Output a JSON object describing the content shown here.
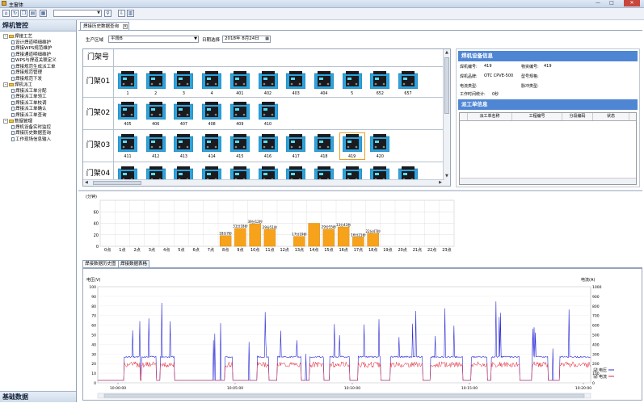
{
  "window": {
    "title": "主窗体",
    "buttons": [
      "—",
      "□",
      "✕"
    ]
  },
  "toolbar": {
    "icons": [
      "home-icon",
      "refresh-icon",
      "copy-icon",
      "save-icon",
      "print-icon",
      "search-icon",
      "export-icon",
      "chart-icon"
    ]
  },
  "nav": {
    "header": "焊机管控",
    "footer": "基础数据",
    "tree": [
      {
        "label": "焊接工艺",
        "level": 0,
        "type": "folder"
      },
      {
        "label": "设计焊道明细维护",
        "level": 1,
        "type": "doc"
      },
      {
        "label": "焊接WPS规范维护",
        "level": 1,
        "type": "doc"
      },
      {
        "label": "焊接通道明细维护",
        "level": 1,
        "type": "doc"
      },
      {
        "label": "WPS与焊道关联定义",
        "level": 1,
        "type": "doc"
      },
      {
        "label": "焊接规范生成派工单",
        "level": 1,
        "type": "doc"
      },
      {
        "label": "焊接规范管理",
        "level": 1,
        "type": "doc"
      },
      {
        "label": "焊接规范下发",
        "level": 1,
        "type": "doc"
      },
      {
        "label": "焊机派工",
        "level": 0,
        "type": "folder"
      },
      {
        "label": "焊接派工单分配",
        "level": 1,
        "type": "doc"
      },
      {
        "label": "焊接派工单领工",
        "level": 1,
        "type": "doc"
      },
      {
        "label": "焊接派工单校调",
        "level": 1,
        "type": "doc"
      },
      {
        "label": "焊接派工单确认",
        "level": 1,
        "type": "doc"
      },
      {
        "label": "焊接派工单查询",
        "level": 1,
        "type": "doc"
      },
      {
        "label": "数据管理",
        "level": 0,
        "type": "folder"
      },
      {
        "label": "焊机设备实时监控",
        "level": 1,
        "type": "doc"
      },
      {
        "label": "焊接历史数据查询",
        "level": 1,
        "type": "doc"
      },
      {
        "label": "工作现场信息输入",
        "level": 1,
        "type": "doc"
      }
    ]
  },
  "tabs": {
    "main": "焊接历史数据查询"
  },
  "filter": {
    "area_label": "生产区域",
    "area_value": "平段B",
    "date_label": "日期选择",
    "date_value": "2018年 8月24日"
  },
  "grid": {
    "header": "门架号",
    "rows": [
      {
        "name": "门架01",
        "machines": [
          "1",
          "2",
          "3",
          "4",
          "401",
          "402",
          "403",
          "404",
          "5",
          "652",
          "657"
        ]
      },
      {
        "name": "门架02",
        "machines": [
          "405",
          "406",
          "407",
          "408",
          "409",
          "410"
        ]
      },
      {
        "name": "门架03",
        "machines": [
          "411",
          "412",
          "413",
          "414",
          "415",
          "416",
          "417",
          "418",
          "419",
          "420"
        ]
      },
      {
        "name": "门架04",
        "machines": [
          "",
          "",
          "",
          "",
          "",
          "",
          "",
          "",
          "",
          "",
          ""
        ]
      }
    ],
    "selected": "419"
  },
  "device": {
    "header": "焊机设备信息",
    "rows": [
      {
        "label": "焊机编号:",
        "value": "419",
        "label2": "物资编号:",
        "value2": "419"
      },
      {
        "label": "焊机品牌:",
        "value": "OTC CPVE-500",
        "label2": "型号规格:",
        "value2": ""
      },
      {
        "label": "电流类型:",
        "value": "",
        "label2": "脉冲类型:",
        "value2": ""
      },
      {
        "label": "工作时间统计:",
        "value": "0秒",
        "label2": "",
        "value2": ""
      }
    ],
    "work_header": "派工单信息",
    "work_columns": [
      "派工单名称",
      "工程编号",
      "分段编码",
      "状态"
    ]
  },
  "bottom_tabs": [
    "焊接数据历史图",
    "焊接数据表格"
  ],
  "chart_data": [
    {
      "type": "bar",
      "ylabel": "(分钟)",
      "ylim": [
        0,
        80
      ],
      "yticks": [
        0,
        20,
        40,
        60
      ],
      "categories": [
        "0点",
        "1点",
        "2点",
        "3点",
        "4点",
        "5点",
        "6点",
        "7点",
        "8点",
        "9点",
        "10点",
        "11点",
        "12点",
        "13点",
        "14点",
        "15点",
        "16点",
        "17点",
        "18点",
        "19点",
        "20点",
        "21点",
        "22点",
        "23点"
      ],
      "values": [
        0,
        0,
        0,
        0,
        0,
        0,
        0,
        0,
        18.7,
        31.3,
        39.2,
        29.8,
        0,
        17.3,
        40.0,
        30.0,
        33.7,
        16.3,
        22.8,
        0,
        0,
        0,
        0,
        0
      ],
      "data_labels": [
        "",
        "",
        "",
        "",
        "",
        "",
        "",
        "",
        "18分7秒",
        "31分18秒",
        "39分12秒",
        "29分51秒",
        "",
        "17分19秒",
        "",
        "29分55秒",
        "33分43秒",
        "16分21秒",
        "22分47秒",
        "",
        "",
        "",
        "",
        ""
      ],
      "bar_color": "#f7a21b"
    },
    {
      "type": "line",
      "ylabel_left": "电压(V)",
      "ylabel_right": "电流(A)",
      "ylim_left": [
        0,
        100
      ],
      "ylim_right": [
        0,
        1000
      ],
      "yticks_left": [
        0,
        10,
        20,
        30,
        40,
        50,
        60,
        70,
        80,
        90,
        100
      ],
      "yticks_right": [
        0,
        100,
        200,
        300,
        400,
        500,
        600,
        700,
        800,
        900,
        1000
      ],
      "x_ticks": [
        "10:00:00",
        "10:05:00",
        "10:10:00",
        "10:15:00",
        "10:20:00"
      ],
      "series": [
        {
          "name": "电压",
          "color": "#2b2bd6"
        },
        {
          "name": "电流",
          "color": "#e0263a"
        }
      ]
    }
  ]
}
